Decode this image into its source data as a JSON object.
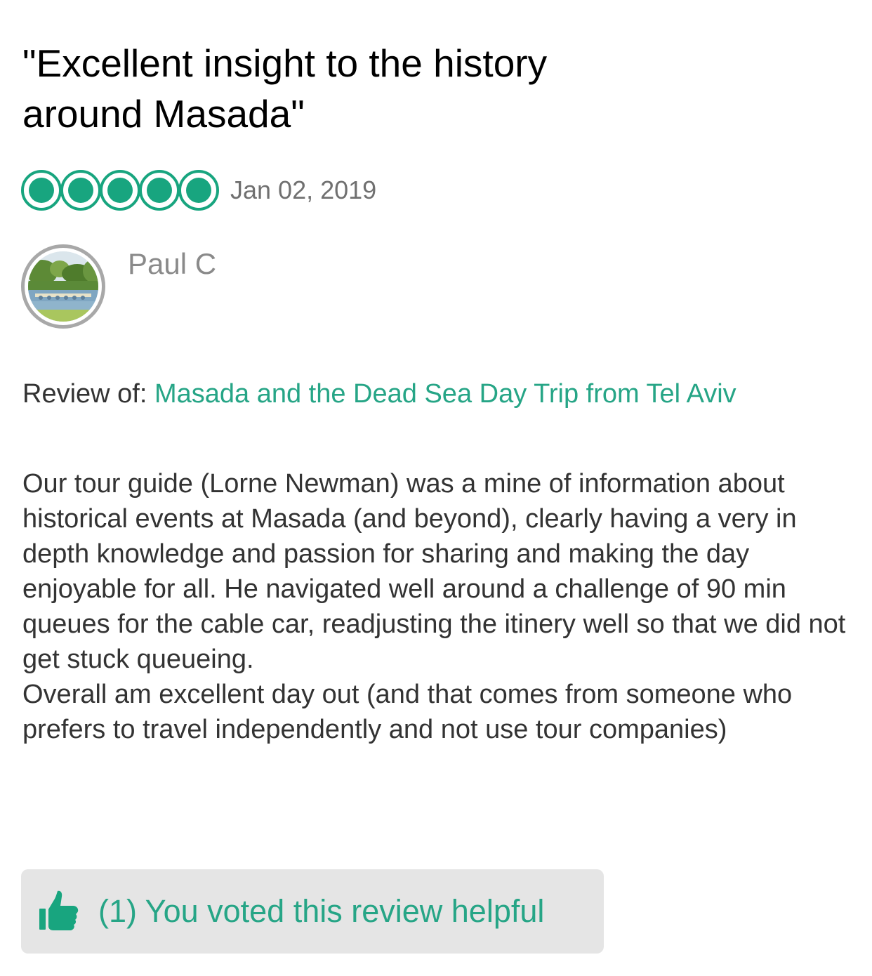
{
  "review": {
    "title_line1": "\"Excellent insight to the history",
    "title_line2": "around Masada\"",
    "rating": 5,
    "rating_max": 5,
    "date": "Jan 02, 2019",
    "reviewer_name": "Paul C",
    "review_of_label": "Review of:",
    "review_of_link": "Masada and the Dead Sea Day Trip from Tel Aviv",
    "body": [
      "Our tour guide (Lorne Newman) was a mine of information about historical events at Masada (and beyond), clearly having a very in depth knowledge and passion for sharing and making the day enjoyable for all.  He navigated well around a challenge of 90 min queues for the cable car, readjusting the itinery well so that we did not get stuck queueing.",
      "Overall am excellent day out (and that comes from someone who prefers to travel independently and not use tour companies)"
    ]
  },
  "helpful": {
    "label": "(1) You voted this review helpful",
    "icon": "thumbs-up-icon"
  },
  "colors": {
    "accent": "#18a57f",
    "link": "#26a586",
    "muted": "#8a8a8a",
    "button_bg": "#e5e5e5"
  }
}
